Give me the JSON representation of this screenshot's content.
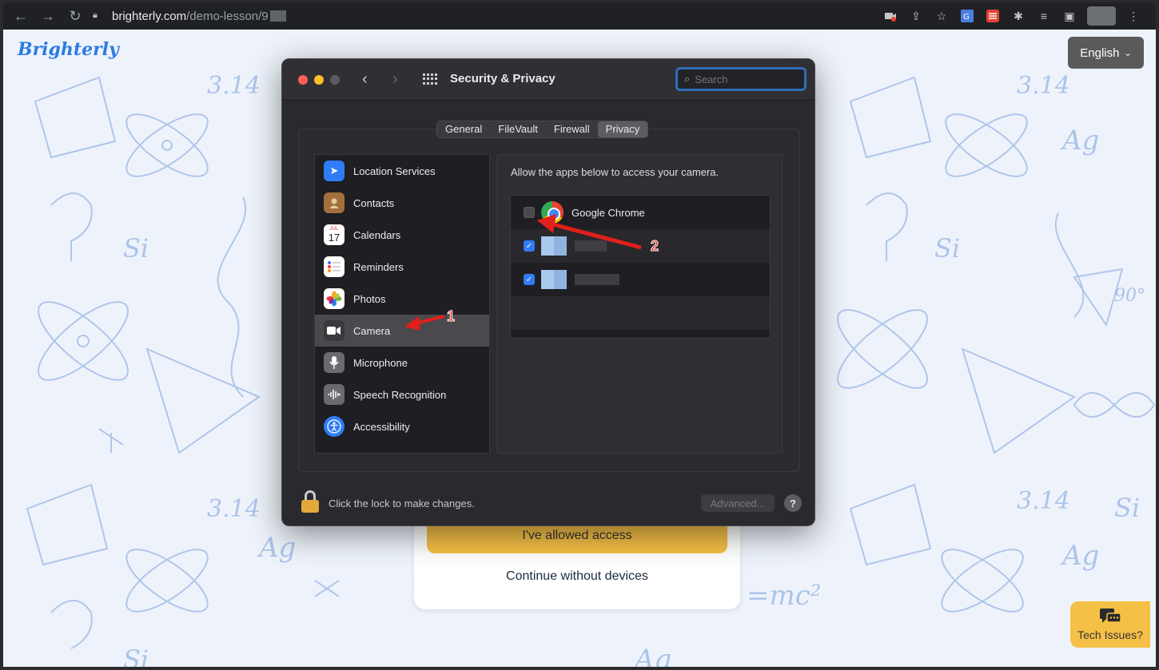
{
  "browser": {
    "url_host": "brighterly.com",
    "url_path": "/demo-lesson/9"
  },
  "page": {
    "logo": "Brighterly",
    "language_button": "English",
    "allowed_button": "I've allowed access",
    "continue_button": "Continue without devices",
    "tech_issues_button": "Tech Issues?"
  },
  "dialog": {
    "title": "Security & Privacy",
    "search_placeholder": "Search",
    "tabs": [
      "General",
      "FileVault",
      "Firewall",
      "Privacy"
    ],
    "active_tab": "Privacy",
    "sidebar": [
      {
        "label": "Location Services",
        "icon": "location-arrow-icon",
        "color": "#2f7cf6"
      },
      {
        "label": "Contacts",
        "icon": "contacts-book-icon",
        "color": "#a1703c"
      },
      {
        "label": "Calendars",
        "icon": "calendar-icon",
        "color": "#ffffff"
      },
      {
        "label": "Reminders",
        "icon": "reminders-list-icon",
        "color": "#ffffff"
      },
      {
        "label": "Photos",
        "icon": "photos-flower-icon",
        "color": "#ffffff"
      },
      {
        "label": "Camera",
        "icon": "camera-icon",
        "color": "#3a3a3c"
      },
      {
        "label": "Microphone",
        "icon": "microphone-icon",
        "color": "#6b6b6f"
      },
      {
        "label": "Speech Recognition",
        "icon": "waveform-icon",
        "color": "#6b6b6f"
      },
      {
        "label": "Accessibility",
        "icon": "accessibility-icon",
        "color": "#2f7cf6"
      }
    ],
    "selected_item": "Camera",
    "calendar_month": "JUL",
    "calendar_day": "17",
    "panel_description": "Allow the apps below to access your camera.",
    "apps": [
      {
        "name": "Google Chrome",
        "checked": false
      },
      {
        "name": "",
        "checked": true
      },
      {
        "name": "",
        "checked": true
      }
    ],
    "footer_text": "Click the lock to make changes.",
    "advanced_button": "Advanced...",
    "help_button": "?"
  },
  "annotations": {
    "marker_1": "1",
    "marker_2": "2"
  }
}
